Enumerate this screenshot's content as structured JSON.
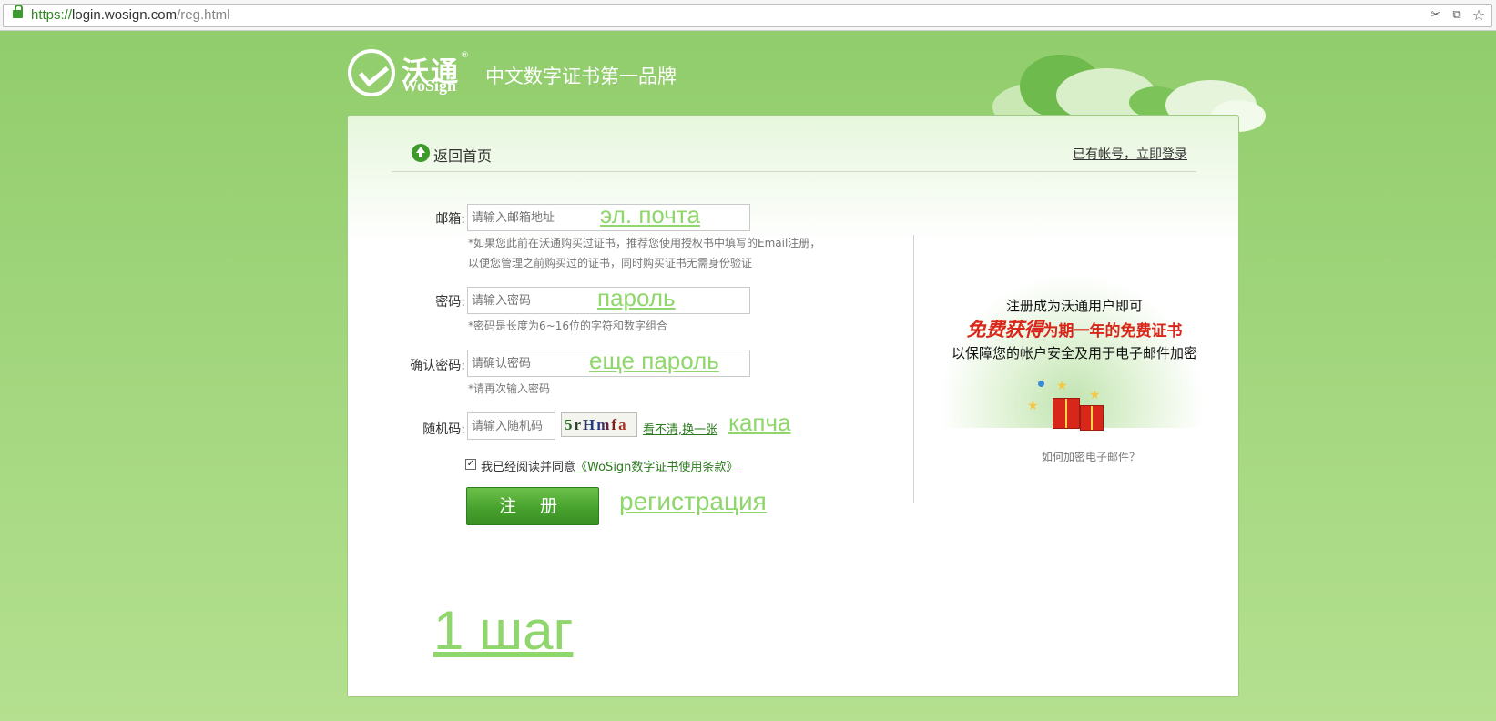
{
  "browser": {
    "url_scheme": "https://",
    "url_host": "login.wosign.com",
    "url_path": "/reg.html"
  },
  "header": {
    "brand_cn": "沃通",
    "brand_reg": "®",
    "brand_en": "WoSign",
    "slogan": "中文数字证书第一品牌"
  },
  "nav": {
    "back_home": "返回首页",
    "login_link": "已有帐号，立即登录"
  },
  "form": {
    "email": {
      "label": "邮箱:",
      "placeholder": "请输入邮箱地址",
      "hint_line1": "*如果您此前在沃通购买过证书，推荐您使用授权书中填写的Email注册，",
      "hint_line2": "以便您管理之前购买过的证书，同时购买证书无需身份验证"
    },
    "password": {
      "label": "密码:",
      "placeholder": "请输入密码",
      "hint": "*密码是长度为6~16位的字符和数字组合"
    },
    "confirm": {
      "label": "确认密码:",
      "placeholder": "请确认密码",
      "hint": "*请再次输入密码"
    },
    "captcha": {
      "label": "随机码:",
      "placeholder": "请输入随机码",
      "image_text": "5rHmfa",
      "refresh_link": "看不清,换一张"
    },
    "agree_text": "我已经阅读并同意",
    "terms_link": "《WoSign数字证书使用条款》",
    "agree_checked": true,
    "submit": "注 册"
  },
  "annotations": {
    "email": "эл. почта",
    "password": "пароль",
    "confirm": "еще пароль",
    "captcha": "капча",
    "register": "регистрация",
    "step": "1 шаг"
  },
  "promo": {
    "line1": "注册成为沃通用户即可",
    "line2_big": "免费获得",
    "line2_rest": "为期一年的免费证书",
    "line3": "以保障您的帐户安全及用于电子邮件加密",
    "encrypt_link": "如何加密电子邮件？"
  },
  "colors": {
    "brand_green": "#45a02c",
    "annotation_green": "#8fd66c",
    "promo_red": "#d8261a"
  }
}
